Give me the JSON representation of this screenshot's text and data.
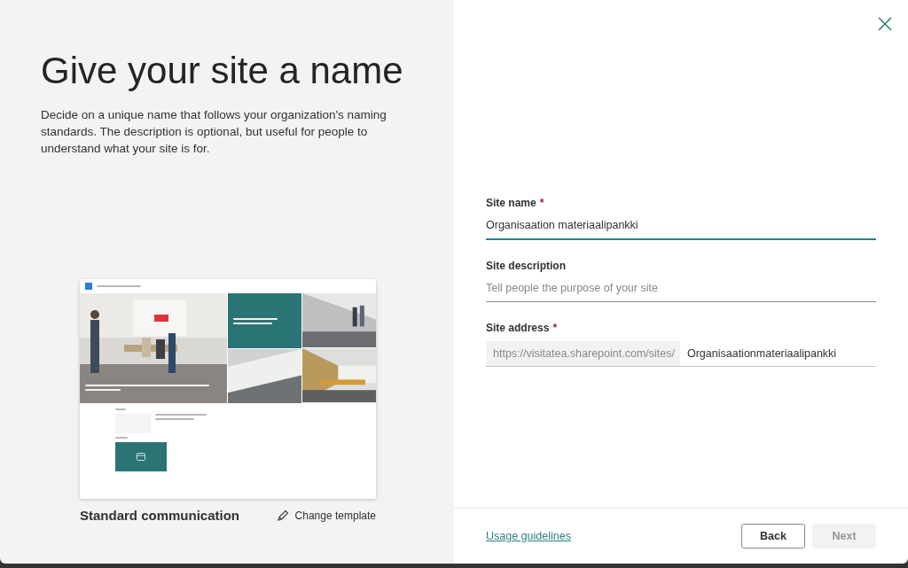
{
  "title": "Give your site a name",
  "intro": "Decide on a unique name that follows your organization's naming standards. The description is optional, but useful for people to understand what your site is for.",
  "required_mark": "*",
  "template_name": "Standard communication",
  "change_template": "Change template",
  "fields": [
    {
      "label": "Site name",
      "required": true,
      "value": "Organisaation materiaalipankki",
      "focused": true
    },
    {
      "label": "Site description",
      "required": false,
      "placeholder": "Tell people the purpose of your site",
      "focused": false
    }
  ],
  "address": {
    "label": "Site address",
    "required": true,
    "prefix": "https://visitatea.sharepoint.com/sites/",
    "value": "Organisaationmateriaalipankki"
  },
  "footer": {
    "link": "Usage guidelines",
    "buttons": [
      {
        "label": "Back",
        "disabled": false
      },
      {
        "label": "Next",
        "disabled": true
      }
    ]
  }
}
